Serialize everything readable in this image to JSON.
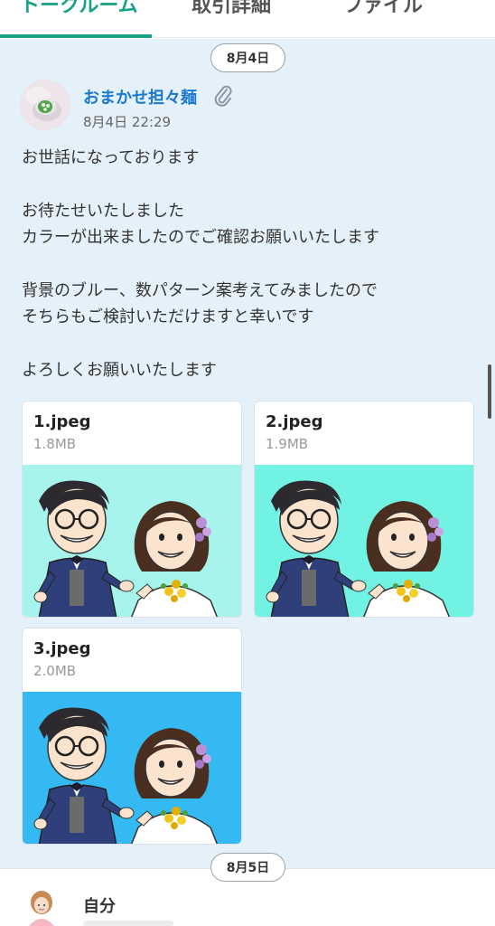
{
  "tabs": [
    {
      "label": "トークルーム",
      "active": true
    },
    {
      "label": "取引詳細",
      "active": false
    },
    {
      "label": "ファイル",
      "active": false
    }
  ],
  "colors": {
    "accent": "#17a287",
    "chat_bg": "#e4f0fa",
    "name_link": "#1a78d2"
  },
  "dates": [
    "8月4日",
    "8月5日"
  ],
  "message": {
    "sender": "おまかせ担々麺",
    "time": "8月4日 22:29",
    "attachment_icon": "paperclip-icon",
    "lines": [
      "お世話になっております",
      "",
      "お待たせいたしました",
      "カラーが出来ましたのでご確認お願いいたします",
      "",
      "背景のブルー、数パターン案考えてみましたので",
      "そちらもご検討いただけますと幸いです",
      "",
      "よろしくお願いいたします"
    ],
    "files": [
      {
        "name": "1.jpeg",
        "size": "1.8MB",
        "bg": "#a7f4ed"
      },
      {
        "name": "2.jpeg",
        "size": "1.9MB",
        "bg": "#72f2e2"
      },
      {
        "name": "3.jpeg",
        "size": "2.0MB",
        "bg": "#34b9f3"
      }
    ]
  },
  "next_message": {
    "sender": "自分"
  }
}
